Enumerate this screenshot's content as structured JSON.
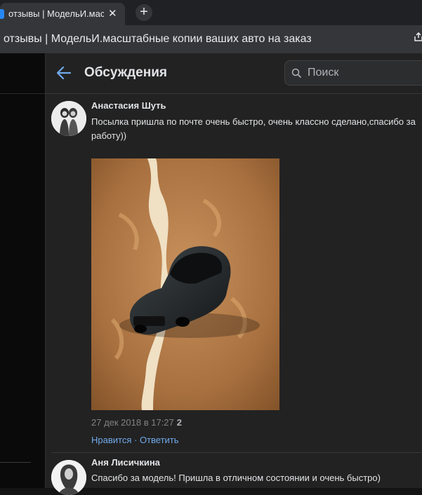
{
  "browser": {
    "tab_title": "отзывы | МодельИ.масштабные",
    "tab_close": "✕",
    "new_tab": "+",
    "page_title": "отзывы | МодельИ.масштабные копии ваших авто на заказ"
  },
  "header": {
    "title": "Обсуждения",
    "search_placeholder": "Поиск"
  },
  "posts": [
    {
      "author": "Анастасия Шуть",
      "text": "Посылка пришла по почте очень быстро, очень классно сделано,спасибо за работу))",
      "date": "27 дек 2018 в 17:27",
      "likes": "2",
      "like_label": "Нравится",
      "separator": "·",
      "reply_label": "Ответить"
    },
    {
      "author": "Аня Лисичкина",
      "text": "Спасибо за модель! Пришла в отличном состоянии и очень быстро)"
    }
  ],
  "colors": {
    "link": "#71aaeb",
    "accent": "#2787f5",
    "background": "#222222"
  }
}
